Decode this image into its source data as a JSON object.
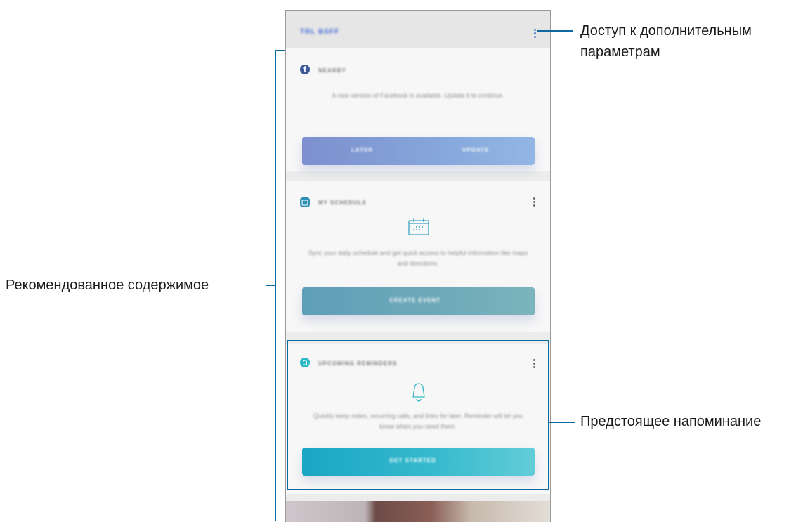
{
  "annotations": {
    "more_options_line1": "Доступ к дополнительным",
    "more_options_line2": "параметрам",
    "recommended": "Рекомендованное содержимое",
    "upcoming": "Предстоящее напоминание"
  },
  "screen": {
    "appbar": {
      "title": "TRL BSFF",
      "more_icon": "more-vert-icon"
    },
    "cards": [
      {
        "icon": "facebook-icon",
        "title": "NEARBY",
        "description": "A new version of Facebook is available. Update it to continue.",
        "buttons": [
          "LATER",
          "UPDATE"
        ]
      },
      {
        "icon": "calendar-icon",
        "title": "MY SCHEDULE",
        "description": "Sync your daily schedule and get quick access to helpful information like maps and directions.",
        "buttons": [
          "CREATE EVENT"
        ]
      },
      {
        "icon": "bell-icon",
        "title": "UPCOMING REMINDERS",
        "description": "Quickly keep notes, recurring calls, and links for later. Reminder will let you know when you need them.",
        "buttons": [
          "GET STARTED"
        ]
      }
    ]
  },
  "colors": {
    "annotation_line": "#0d6aa0",
    "facebook": "#3b5998",
    "reminder_accent": "#2bb8c6"
  }
}
